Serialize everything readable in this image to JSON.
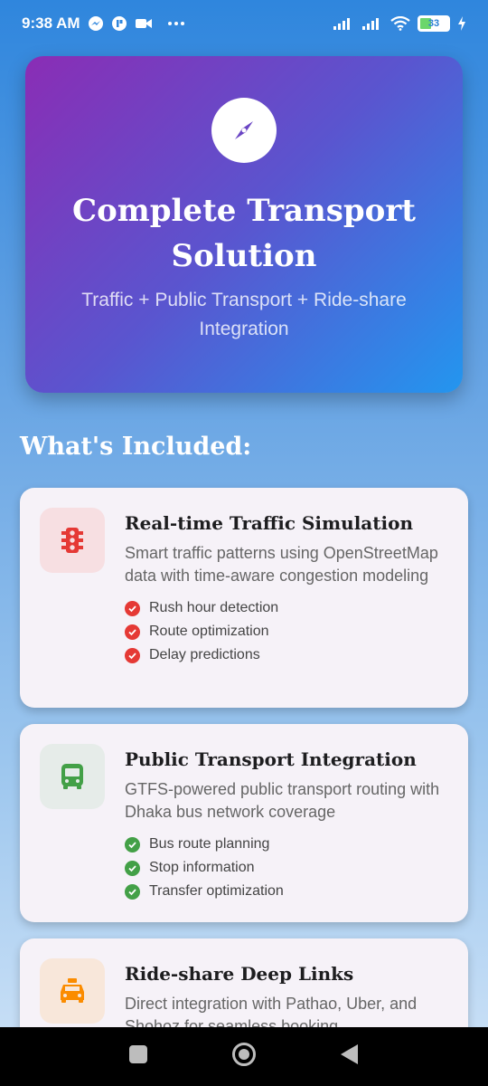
{
  "status_bar": {
    "time": "9:38 AM",
    "battery": "33",
    "icons": [
      "messenger-icon",
      "app-icon",
      "video-icon",
      "more-icon",
      "signal-icon",
      "signal-icon-2",
      "wifi-icon",
      "battery-icon",
      "charging-icon"
    ]
  },
  "hero": {
    "icon": "compass-icon",
    "title": "Complete Transport Solution",
    "subtitle": "Traffic + Public Transport + Ride-share Integration"
  },
  "section_title": "What's Included:",
  "features": [
    {
      "icon": "traffic-light-icon",
      "title": "Real-time Traffic Simulation",
      "description": "Smart traffic patterns using OpenStreetMap data with time-aware congestion modeling",
      "points": [
        "Rush hour detection",
        "Route optimization",
        "Delay predictions"
      ],
      "color": "#e53935",
      "bg": "#f7dfe2"
    },
    {
      "icon": "bus-icon",
      "title": "Public Transport Integration",
      "description": "GTFS-powered public transport routing with Dhaka bus network coverage",
      "points": [
        "Bus route planning",
        "Stop information",
        "Transfer optimization"
      ],
      "color": "#43a047",
      "bg": "#e6ece9"
    },
    {
      "icon": "taxi-icon",
      "title": "Ride-share Deep Links",
      "description": "Direct integration with Pathao, Uber, and Shohoz for seamless booking",
      "points": [],
      "color": "#fb8c00",
      "bg": "#f8e7da"
    }
  ],
  "nav": {
    "recent": "square-icon",
    "home": "circle-icon",
    "back": "triangle-back-icon"
  }
}
